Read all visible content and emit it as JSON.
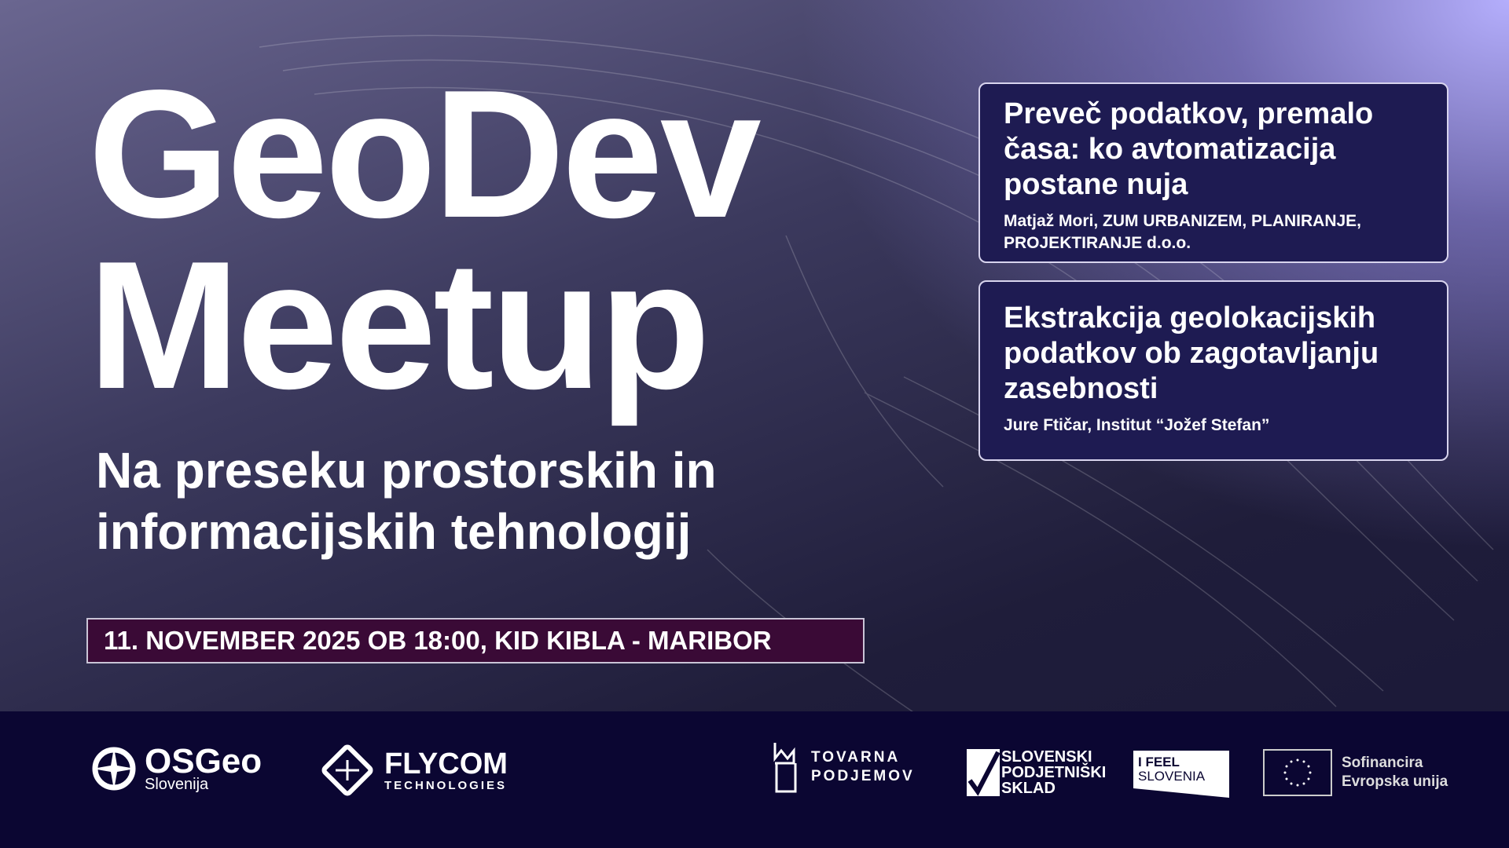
{
  "title": {
    "line1": "GeoDev",
    "line2": "Meetup"
  },
  "subtitle": {
    "line1": "Na preseku prostorskih in",
    "line2": "informacijskih tehnologij"
  },
  "date_location": "11. NOVEMBER 2025 OB 18:00, KID KIBLA - MARIBOR",
  "talks": [
    {
      "title": "Preveč podatkov, premalo časa: ko avtomatizacija postane nuja",
      "speaker": "Matjaž Mori, ZUM URBANIZEM, PLANIRANJE, PROJEKTIRANJE d.o.o."
    },
    {
      "title": "Ekstrakcija geolokacijskih podatkov ob zagotavljanju zasebnosti",
      "speaker": "Jure Ftičar, Institut “Jožef Stefan”"
    }
  ],
  "sponsors": {
    "osgeo": {
      "name": "OSGeo",
      "sub": "Slovenija"
    },
    "flycom": {
      "name": "FLYCOM",
      "sub": "TECHNOLOGIES"
    },
    "tovarna": {
      "line1": "TOVARNA",
      "line2": "PODJEMOV"
    },
    "sps": {
      "line1": "SLOVENSKI",
      "line2": "PODJETNIŠKI",
      "line3": "SKLAD"
    },
    "ifeel": {
      "line1": "I FEEL",
      "line2": "SLOVENIA"
    },
    "eu": {
      "line1": "Sofinancira",
      "line2": "Evropska unija"
    }
  },
  "colors": {
    "card": "#1e1b52",
    "date_bg": "#3a0a36",
    "footer": "#0b0632"
  }
}
